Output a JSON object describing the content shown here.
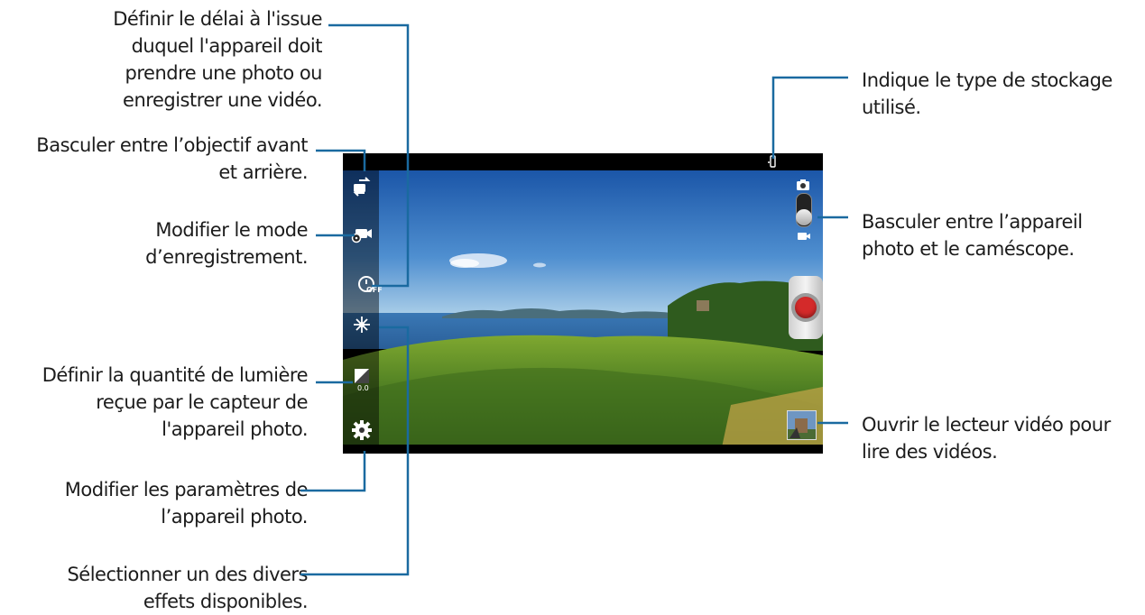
{
  "callouts": {
    "timer": [
      "Définir le délai à l'issue",
      "duquel l'appareil doit",
      "prendre une photo ou",
      "enregistrer une vidéo."
    ],
    "switch_lens": [
      "Basculer entre l’objectif avant",
      "et arrière."
    ],
    "record_mode": [
      "Modifier le mode",
      "d’enregistrement."
    ],
    "exposure": [
      "Définir la quantité de lumière",
      "reçue par le capteur de",
      "l'appareil photo."
    ],
    "settings": [
      "Modifier les paramètres de",
      "l’appareil photo."
    ],
    "effects": [
      "Sélectionner un des divers",
      "effets disponibles."
    ],
    "storage": [
      "Indique le type de stockage",
      "utilisé."
    ],
    "camera_camcorder": [
      "Basculer entre l’appareil",
      "photo et le caméscope."
    ],
    "video_player": [
      "Ouvrir le lecteur vidéo pour",
      "lire des vidéos."
    ]
  },
  "icons": {
    "switch_lens": "camera-flip-icon",
    "record_mode": "video-mode-icon",
    "timer": "timer-off-icon",
    "effects": "effects-wand-icon",
    "exposure": "exposure-icon",
    "settings": "gear-icon",
    "storage": "phone-storage-icon",
    "camera": "camera-icon",
    "camcorder": "camcorder-icon"
  },
  "labels": {
    "timer_state": "OFF",
    "exposure_value": "0.0"
  },
  "colors": {
    "leader": "#1a6aa0",
    "record": "#d42a2a",
    "text": "#1c1c1c"
  }
}
